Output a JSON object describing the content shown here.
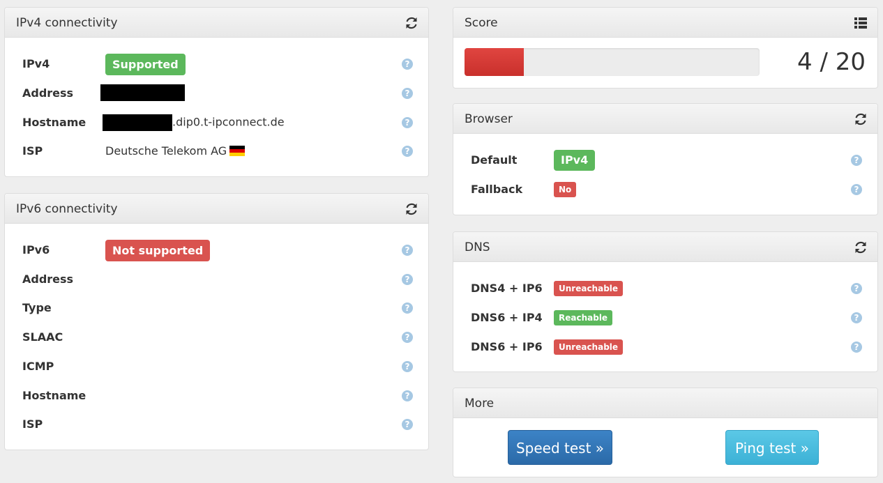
{
  "ipv4": {
    "title": "IPv4 connectivity",
    "rows": [
      {
        "label": "IPv4",
        "badge": "Supported"
      },
      {
        "label": "Address"
      },
      {
        "label": "Hostname",
        "suffix": ".dip0.t-ipconnect.de"
      },
      {
        "label": "ISP",
        "value": "Deutsche Telekom AG"
      }
    ]
  },
  "ipv6": {
    "title": "IPv6 connectivity",
    "rows": [
      {
        "label": "IPv6",
        "badge": "Not supported"
      },
      {
        "label": "Address"
      },
      {
        "label": "Type"
      },
      {
        "label": "SLAAC"
      },
      {
        "label": "ICMP"
      },
      {
        "label": "Hostname"
      },
      {
        "label": "ISP"
      }
    ]
  },
  "score": {
    "title": "Score",
    "text": "4 / 20",
    "value": 4,
    "max": 20
  },
  "browser": {
    "title": "Browser",
    "rows": [
      {
        "label": "Default",
        "badge": "IPv4"
      },
      {
        "label": "Fallback",
        "badge": "No"
      }
    ]
  },
  "dns": {
    "title": "DNS",
    "rows": [
      {
        "label": "DNS4 + IP6",
        "badge": "Unreachable"
      },
      {
        "label": "DNS6 + IP4",
        "badge": "Reachable"
      },
      {
        "label": "DNS6 + IP6",
        "badge": "Unreachable"
      }
    ]
  },
  "more": {
    "title": "More",
    "speed_test": "Speed test »",
    "ping_test": "Ping test »"
  },
  "icons": {
    "refresh": "refresh-icon",
    "list": "list-icon",
    "help": "question-circle-icon",
    "flag": "germany-flag-icon"
  },
  "colors": {
    "success": "#5cb85c",
    "danger": "#d9534f",
    "primary": "#2b6aa8",
    "info": "#3cb1d6"
  }
}
